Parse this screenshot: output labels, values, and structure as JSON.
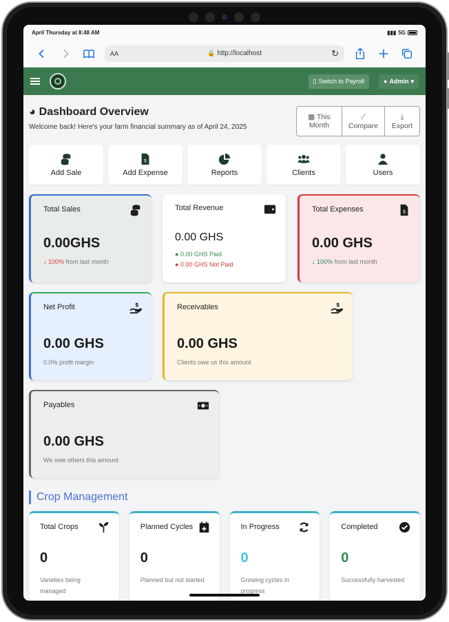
{
  "status": {
    "time": "April Thursday at 8:48 AM",
    "network": "5G"
  },
  "browser": {
    "text_size": "AA",
    "url": "http://localhost"
  },
  "navbar": {
    "payroll_label": "Switch to Payroll",
    "admin_label": "Admin"
  },
  "header": {
    "title": "Dashboard Overview",
    "subtitle": "Welcome back! Here's your farm financial summary as of April 24, 2025"
  },
  "period": {
    "this_line1": "This",
    "this_line2": "Month",
    "compare": "Compare",
    "export": "Export"
  },
  "quick_actions": [
    "Add Sale",
    "Add Expense",
    "Reports",
    "Clients",
    "Users"
  ],
  "cards": {
    "total_sales": {
      "title": "Total Sales",
      "value": "0.00GHS",
      "pct": "100%",
      "note": "from last month"
    },
    "total_revenue": {
      "title": "Total Revenue",
      "value": "0.00 GHS",
      "paid": "0.00 GHS Paid",
      "not_paid": "0.00 GHS Not Paid"
    },
    "total_expenses": {
      "title": "Total Expenses",
      "value": "0.00 GHS",
      "pct": "100%",
      "note": "from last month"
    },
    "net_profit": {
      "title": "Net Profit",
      "value": "0.00 GHS",
      "note": "0.0% profit margin"
    },
    "receivables": {
      "title": "Receivables",
      "value": "0.00 GHS",
      "note": "Clients owe us this amount"
    },
    "payables": {
      "title": "Payables",
      "value": "0.00 GHS",
      "note": "We owe others this amount"
    }
  },
  "crop_section": {
    "title": "Crop Management"
  },
  "crops": [
    {
      "title": "Total Crops",
      "value": "0",
      "sub": "Varieties being managed",
      "icon": "seedling-icon"
    },
    {
      "title": "Planned Cycles",
      "value": "0",
      "sub": "Planned but not started",
      "icon": "calendar-plus-icon"
    },
    {
      "title": "In Progress",
      "value": "0",
      "sub": "Growing cycles in progress",
      "icon": "sync-icon"
    },
    {
      "title": "Completed",
      "value": "0",
      "sub": "Successfully harvested",
      "icon": "check-circle-icon"
    }
  ],
  "colors": {
    "nav": "#3b7a4e",
    "sales_border": "#3f6fd1",
    "expenses_border": "#d63c3c",
    "profit_border": "#2fae5c",
    "receivables_border": "#e5b72a",
    "payables_border": "#666666",
    "in_progress": "#3ec3dc",
    "completed": "#2e8b57"
  }
}
